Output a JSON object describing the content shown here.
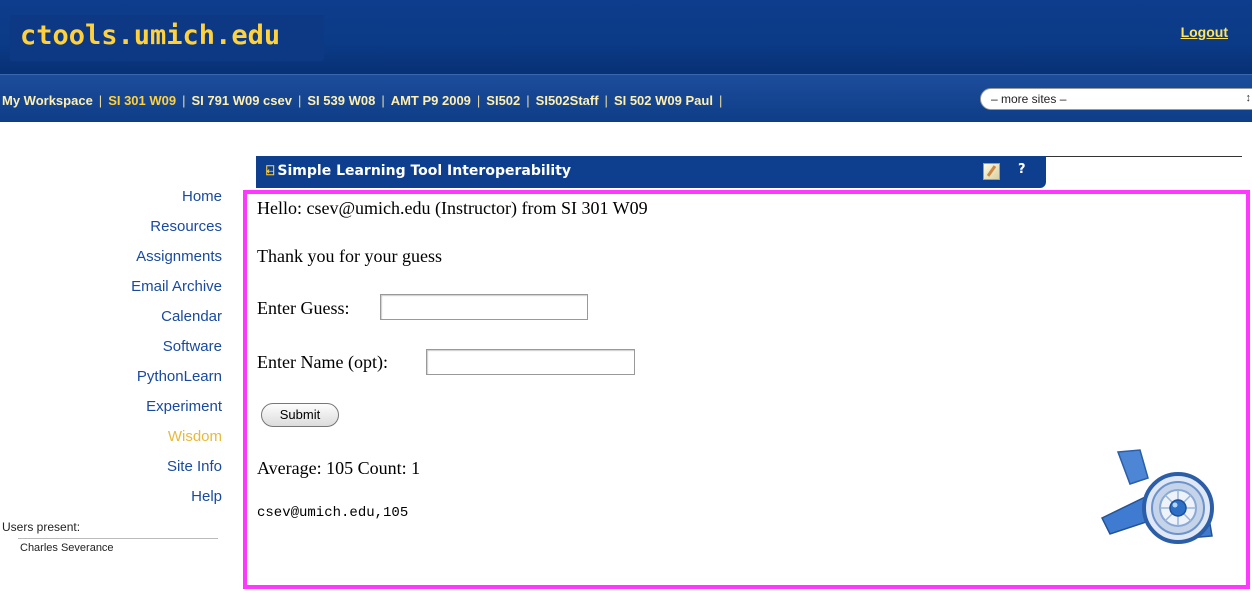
{
  "header": {
    "logo_text": "ctools.umich.edu",
    "logout_label": "Logout"
  },
  "sitenav": {
    "tabs": [
      {
        "label": "My Workspace",
        "active": false
      },
      {
        "label": "SI 301 W09",
        "active": true
      },
      {
        "label": "SI 791 W09 csev",
        "active": false
      },
      {
        "label": "SI 539 W08",
        "active": false
      },
      {
        "label": "AMT P9 2009",
        "active": false
      },
      {
        "label": "SI502",
        "active": false
      },
      {
        "label": "SI502Staff",
        "active": false
      },
      {
        "label": "SI 502 W09 Paul",
        "active": false
      }
    ],
    "separator": "|",
    "more_sites_value": "– more sites –"
  },
  "toolmenu": {
    "items": [
      {
        "label": "Home"
      },
      {
        "label": "Resources"
      },
      {
        "label": "Assignments"
      },
      {
        "label": "Email Archive"
      },
      {
        "label": "Calendar"
      },
      {
        "label": "Software"
      },
      {
        "label": "PythonLearn"
      },
      {
        "label": "Experiment"
      },
      {
        "label": "Wisdom",
        "active": true
      },
      {
        "label": "Site Info"
      },
      {
        "label": "Help"
      }
    ],
    "users_present_label": "Users present:",
    "users": [
      "Charles Severance"
    ],
    "active_color": "#e8b93a",
    "link_color": "#1a4aa0"
  },
  "tool": {
    "title": "Simple Learning Tool Interoperability",
    "title_icon": "link-icon",
    "help_label": "?"
  },
  "lti": {
    "hello_text": "Hello: csev@umich.edu (Instructor) from SI 301 W09",
    "thanks_text": "Thank you for your guess",
    "guess_label": "Enter Guess:",
    "guess_value": "",
    "name_label": "Enter Name (opt):",
    "name_value": "",
    "submit_label": "Submit",
    "average_text": "Average: 105 Count: 1",
    "result_line": "csev@umich.edu,105",
    "frame_color": "#ff38ff"
  }
}
